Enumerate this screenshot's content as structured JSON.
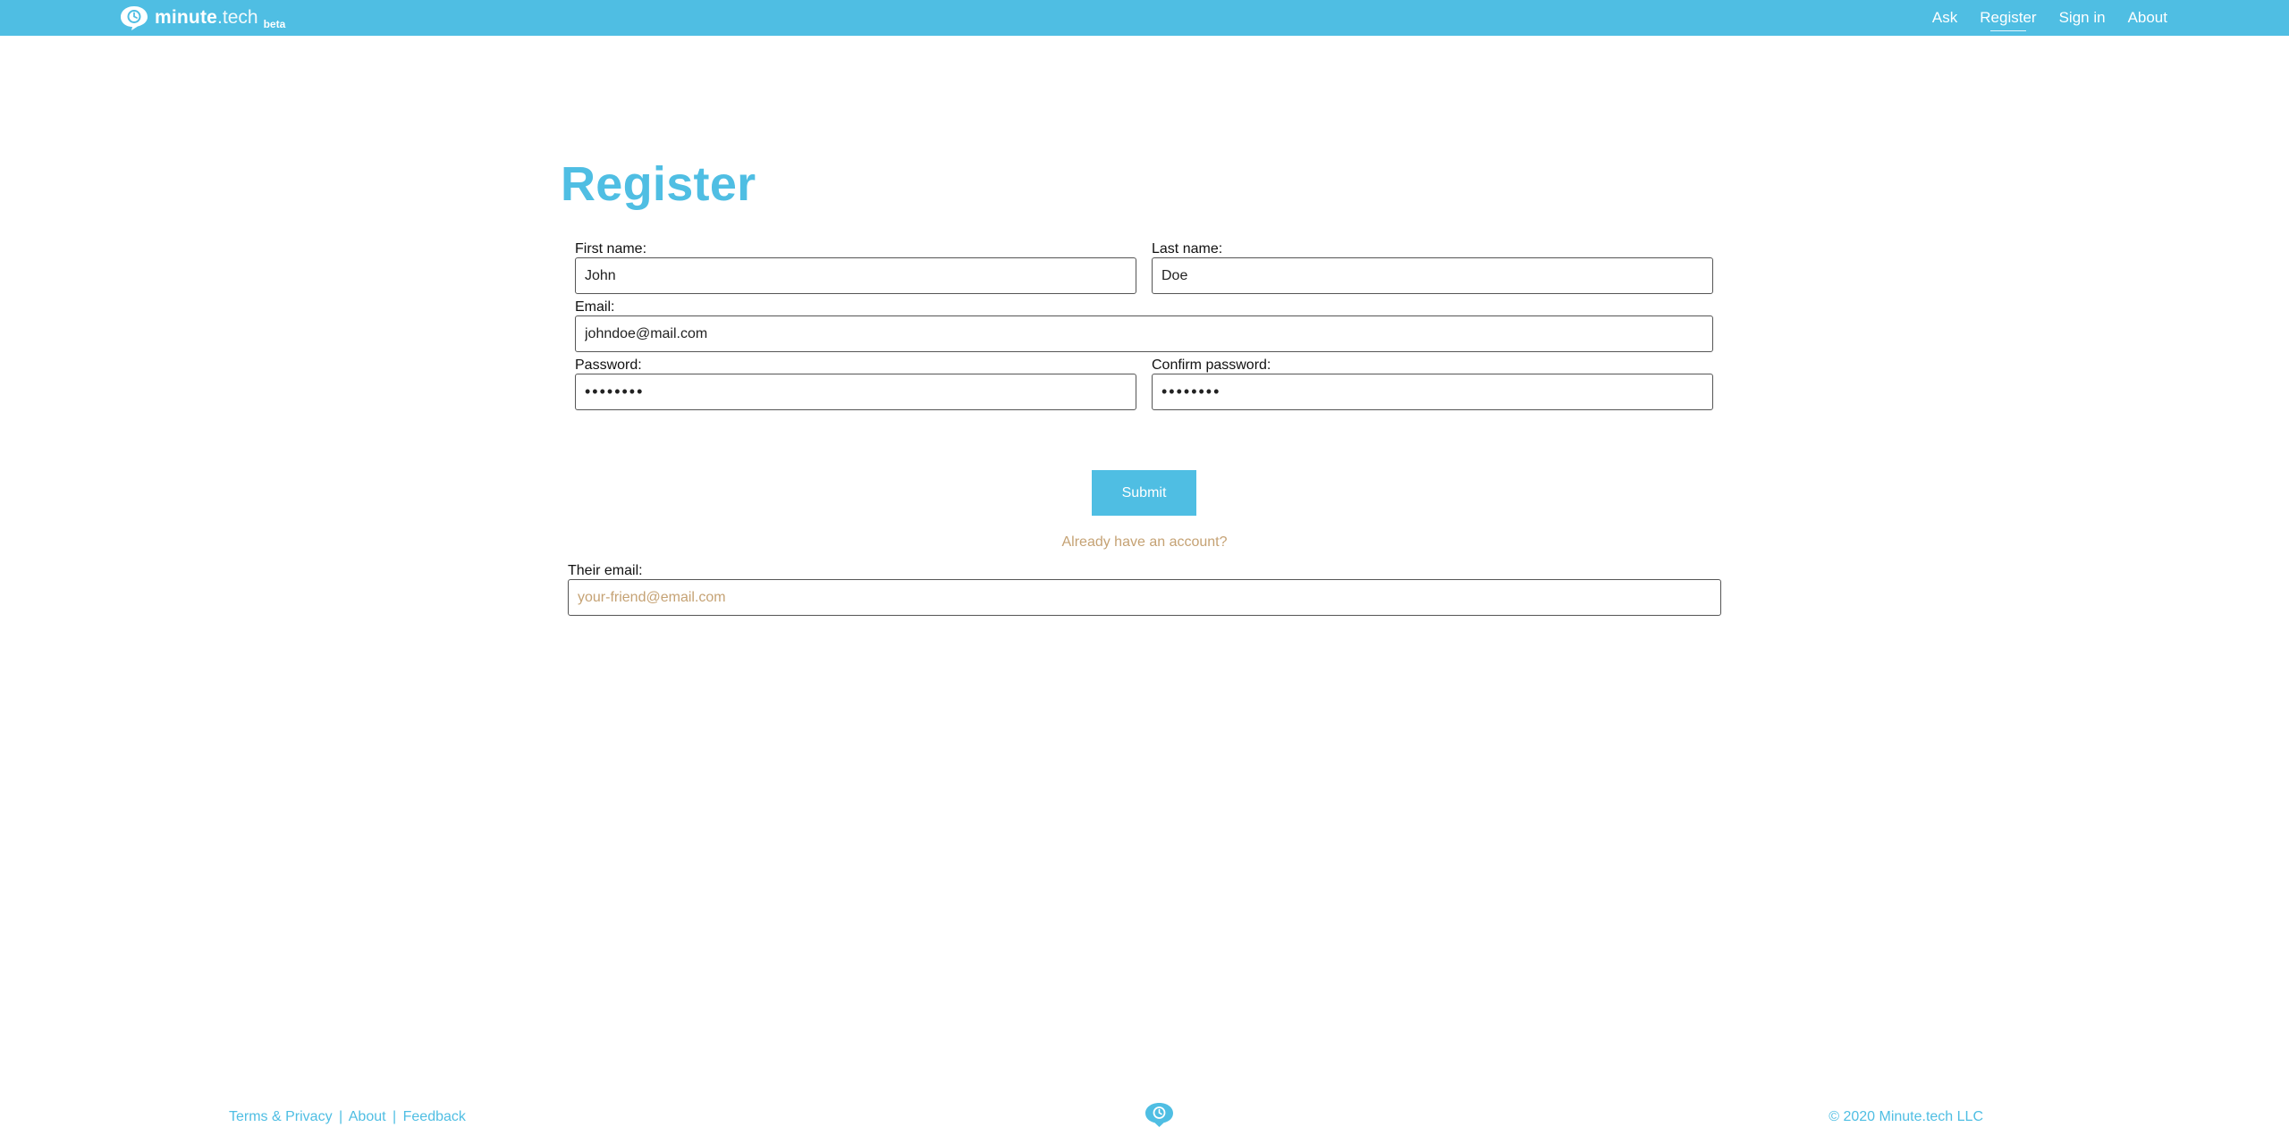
{
  "header": {
    "brand_bold": "minute",
    "brand_light": ".tech",
    "brand_tag": "beta",
    "nav": [
      "Ask",
      "Register",
      "Sign in",
      "About"
    ],
    "active_nav": "Register",
    "accent_color": "#4fbee3"
  },
  "form": {
    "title": "Register",
    "first_name": {
      "label": "First name:",
      "value": "John"
    },
    "last_name": {
      "label": "Last name:",
      "value": "Doe"
    },
    "email": {
      "label": "Email:",
      "value": "johndoe@mail.com"
    },
    "password": {
      "label": "Password:",
      "value": "••••••••"
    },
    "confirm_password": {
      "label": "Confirm password:",
      "value": "••••••••"
    },
    "submit_label": "Submit",
    "have_account": "Already have an account?",
    "their_email": {
      "label": "Their email:",
      "placeholder": "your-friend@email.com"
    }
  },
  "footer": {
    "links": [
      "Terms & Privacy",
      "About",
      "Feedback"
    ],
    "separator": "|",
    "copyright": "© 2020 Minute.tech LLC"
  },
  "icons": {
    "brand_logo": "speech-bubble-clock-icon",
    "footer_logo": "speech-bubble-clock-icon"
  }
}
